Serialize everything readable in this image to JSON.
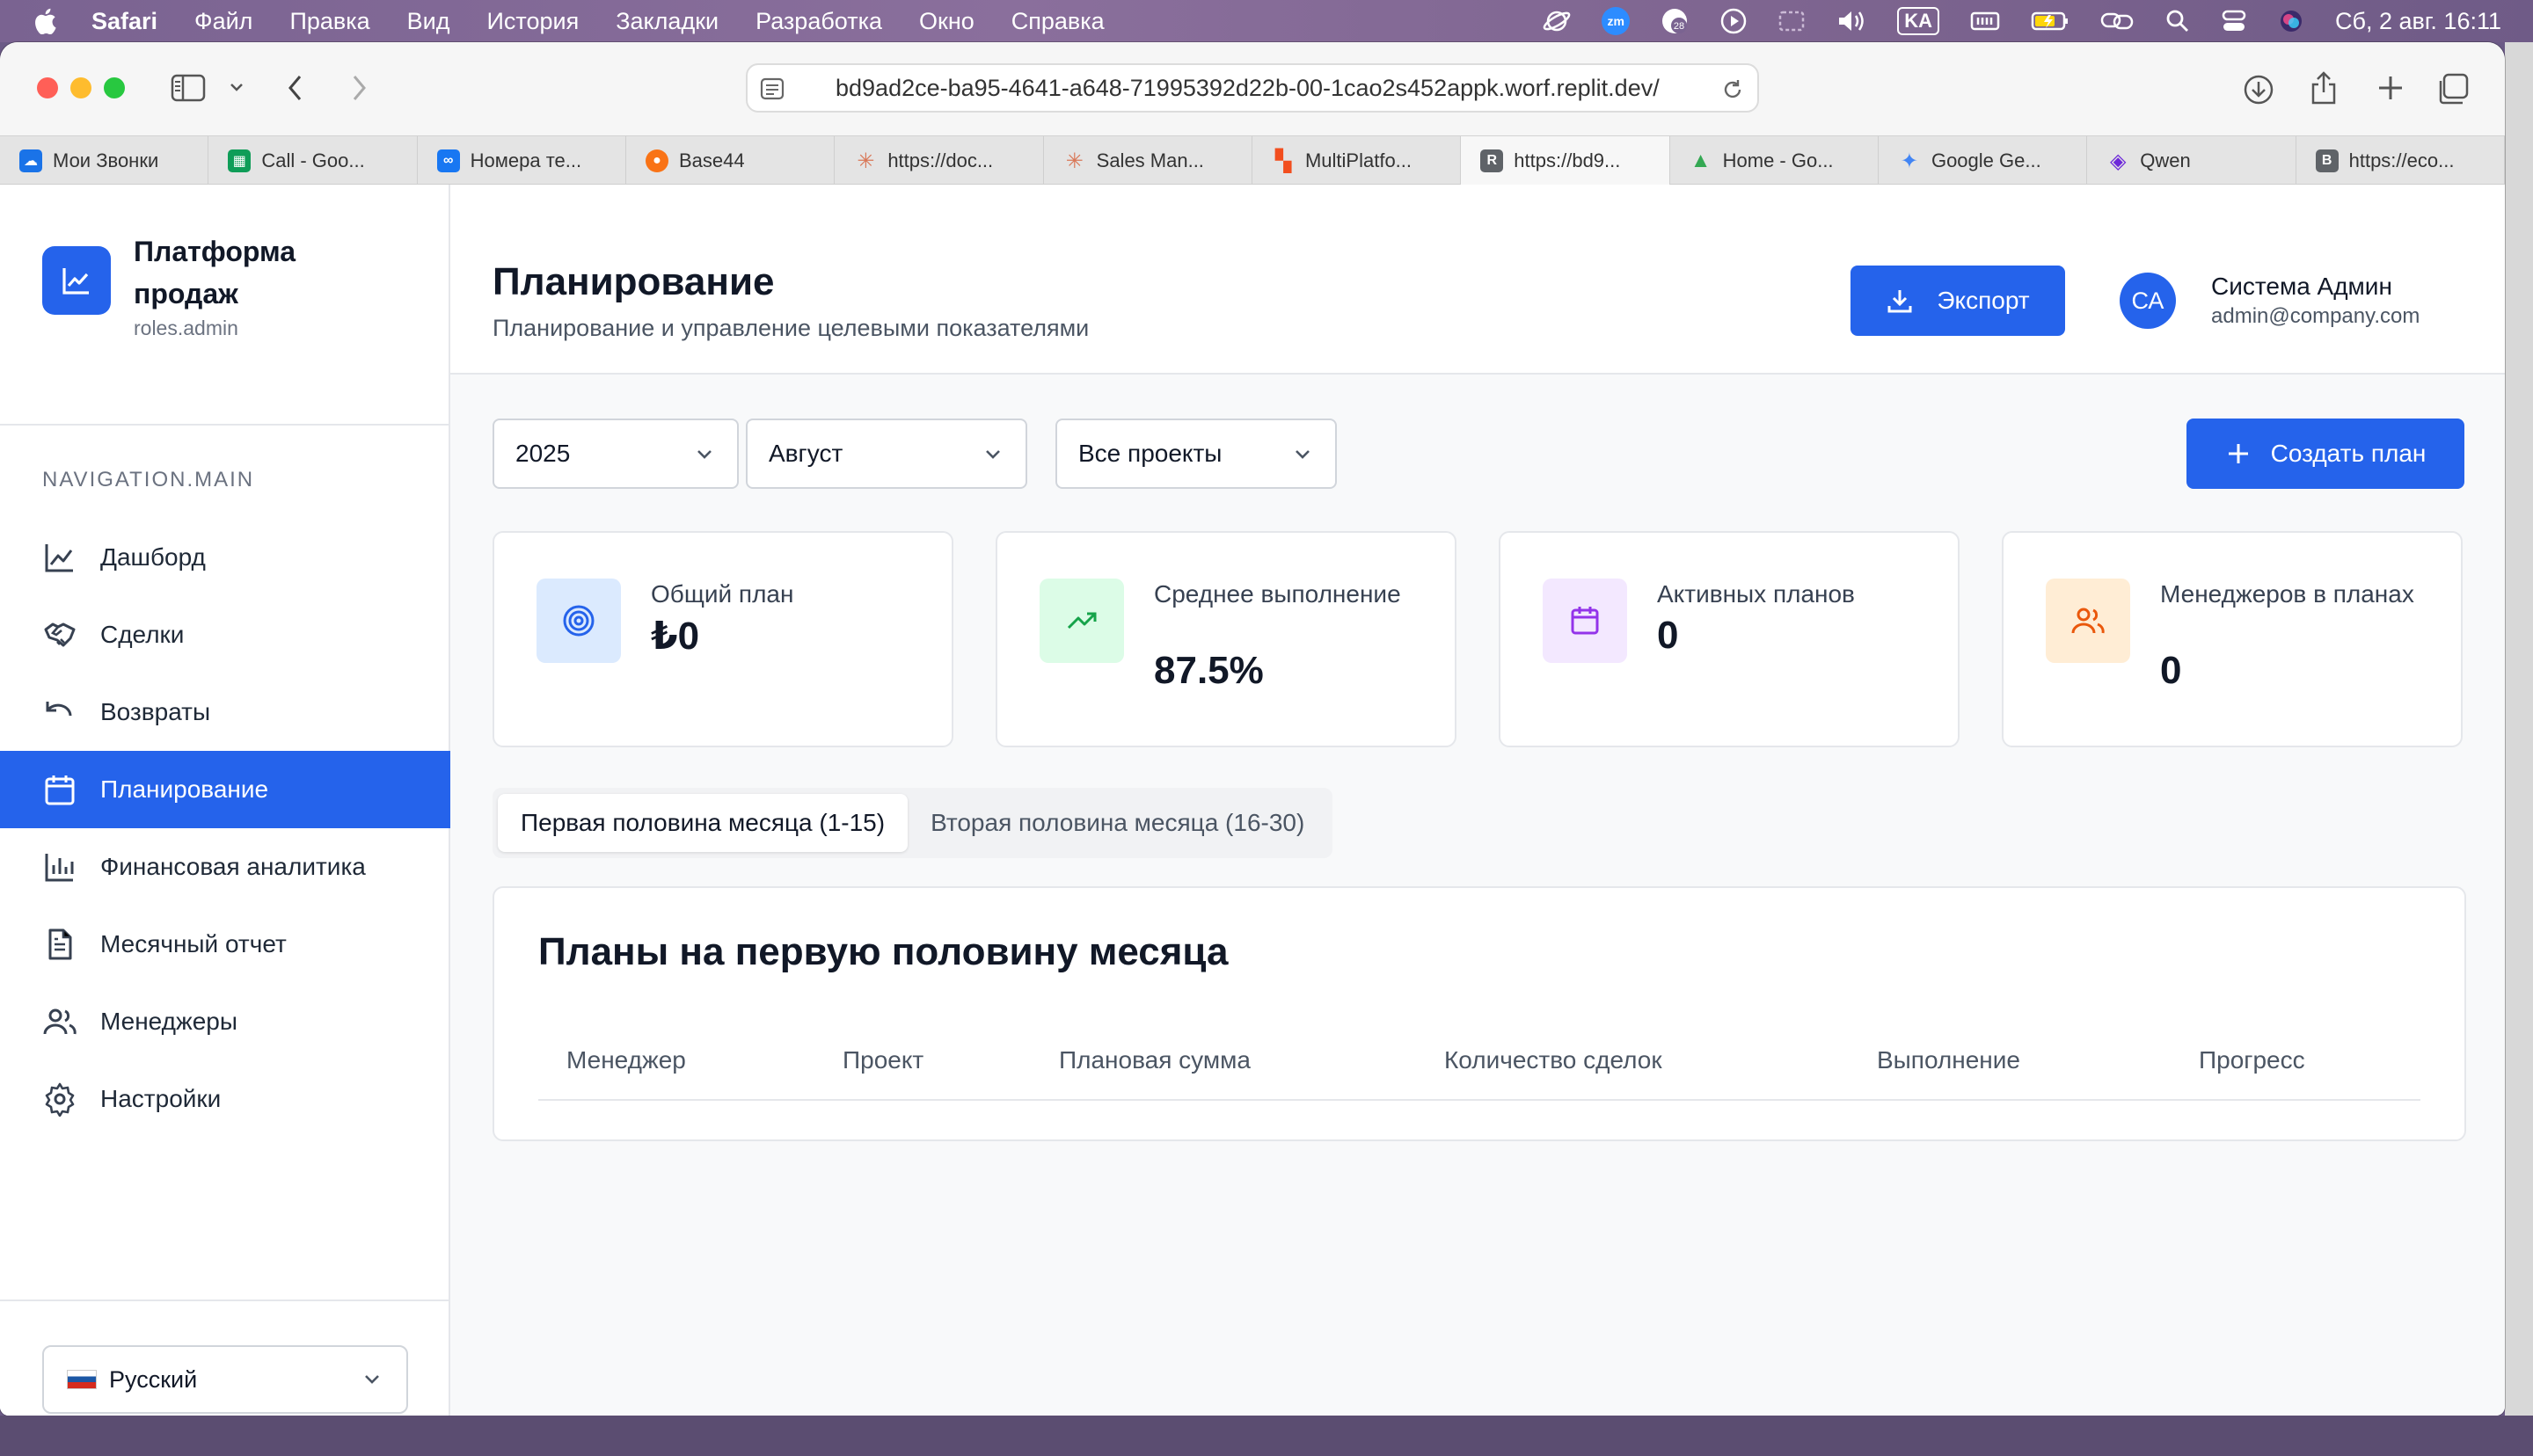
{
  "menubar": {
    "app": "Safari",
    "items": [
      "Файл",
      "Правка",
      "Вид",
      "История",
      "Закладки",
      "Разработка",
      "Окно",
      "Справка"
    ],
    "keyboard": "KA",
    "datetime": "Сб, 2 авг.  16:11"
  },
  "browser": {
    "url": "bd9ad2ce-ba95-4641-a648-71995392d22b-00-1cao2s452appk.worf.replit.dev/",
    "tabs": [
      {
        "label": "Мои Звонки",
        "color": "#1a73e8",
        "glyph": "☁"
      },
      {
        "label": "Call - Goo...",
        "color": "#0f9d58",
        "glyph": "▦"
      },
      {
        "label": "Номера те...",
        "color": "#1877f2",
        "glyph": "∞"
      },
      {
        "label": "Base44",
        "color": "#f97316",
        "glyph": "●"
      },
      {
        "label": "https://doc...",
        "color": "#d97757",
        "glyph": "✳"
      },
      {
        "label": "Sales Man...",
        "color": "#d97757",
        "glyph": "✳"
      },
      {
        "label": "MultiPlatfo...",
        "color": "#f24e1e",
        "glyph": "▚"
      },
      {
        "label": "https://bd9...",
        "color": "#5f6368",
        "glyph": "R"
      },
      {
        "label": "Home - Go...",
        "color": "#34a853",
        "glyph": "▲"
      },
      {
        "label": "Google Ge...",
        "color": "#4285f4",
        "glyph": "✦"
      },
      {
        "label": "Qwen",
        "color": "#6d28d9",
        "glyph": "◈"
      },
      {
        "label": "https://eco...",
        "color": "#5f6368",
        "glyph": "B"
      }
    ]
  },
  "sidebar": {
    "brand_name": "Платформа продаж",
    "brand_role": "roles.admin",
    "nav_label": "NAVIGATION.MAIN",
    "items": [
      {
        "label": "Дашборд"
      },
      {
        "label": "Сделки"
      },
      {
        "label": "Возвраты"
      },
      {
        "label": "Планирование"
      },
      {
        "label": "Финансовая аналитика"
      },
      {
        "label": "Месячный отчет"
      },
      {
        "label": "Менеджеры"
      },
      {
        "label": "Настройки"
      }
    ],
    "language": "Русский"
  },
  "header": {
    "title": "Планирование",
    "subtitle": "Планирование и управление целевыми показателями",
    "export_label": "Экспорт",
    "avatar_initials": "СА",
    "user_name": "Система Админ",
    "user_email": "admin@company.com"
  },
  "filters": {
    "year": "2025",
    "month": "Август",
    "project": "Все проекты",
    "create_label": "Создать план"
  },
  "stats": [
    {
      "label": "Общий план",
      "value": "₺0"
    },
    {
      "label": "Среднее выполнение",
      "value": "87.5%"
    },
    {
      "label": "Активных планов",
      "value": "0"
    },
    {
      "label": "Менеджеров в планах",
      "value": "0"
    }
  ],
  "period_tabs": [
    "Первая половина месяца (1-15)",
    "Вторая половина месяца (16-30)"
  ],
  "plans": {
    "title": "Планы на первую половину месяца",
    "columns": [
      "Менеджер",
      "Проект",
      "Плановая сумма",
      "Количество сделок",
      "Выполнение",
      "Прогресс"
    ]
  },
  "colors": {
    "accent": "#2563eb",
    "stat_blue_bg": "#dbeafe",
    "stat_green_bg": "#dcfce7",
    "stat_purple_bg": "#f3e8ff",
    "stat_orange_bg": "#ffedd5"
  }
}
